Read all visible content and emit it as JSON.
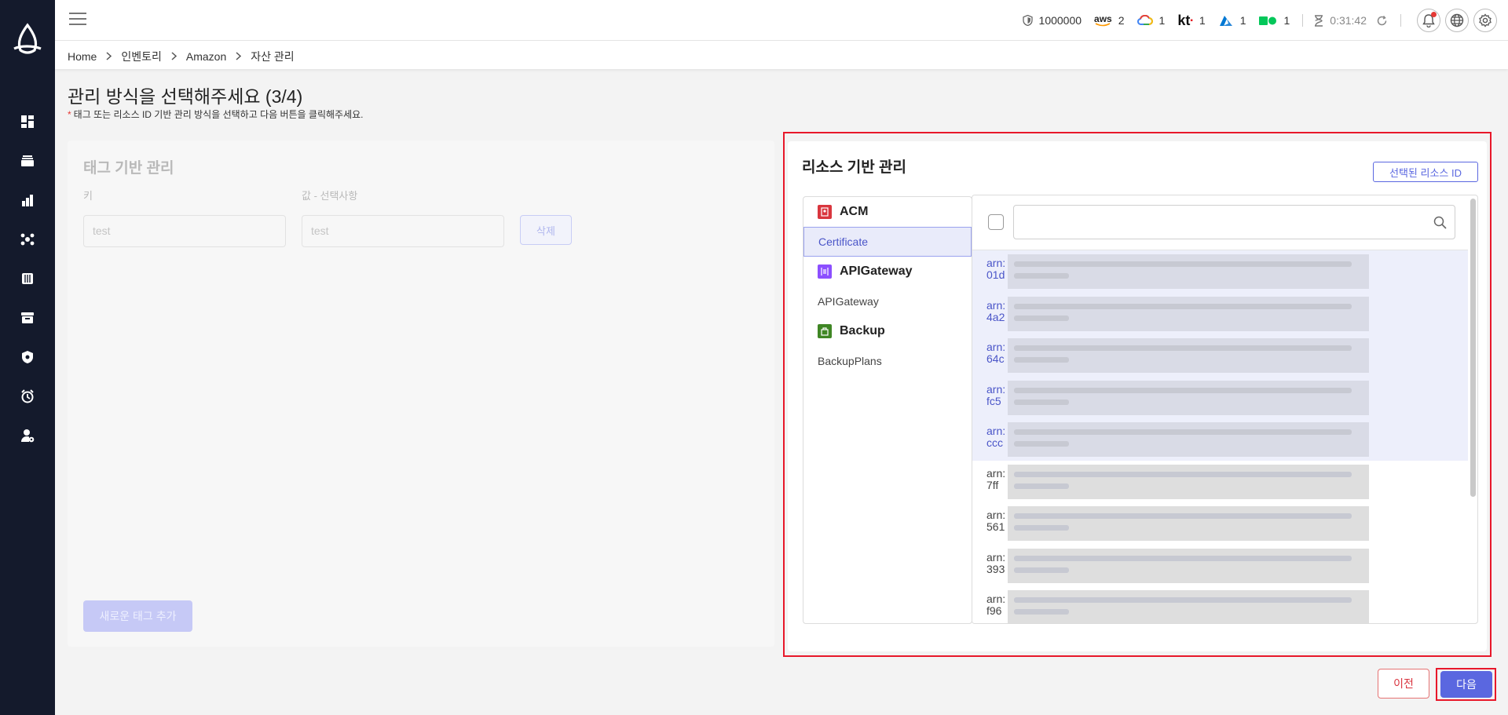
{
  "header": {
    "shield_count": "1000000",
    "providers": [
      {
        "name": "aws",
        "count": "2"
      },
      {
        "name": "gcp",
        "count": "1"
      },
      {
        "name": "kt",
        "count": "1"
      },
      {
        "name": "azure",
        "count": "1"
      },
      {
        "name": "naver",
        "count": "1"
      }
    ],
    "aws_text": "aws",
    "kt_text": "kt",
    "timer": "0:31:42"
  },
  "breadcrumb": [
    "Home",
    "인벤토리",
    "Amazon",
    "자산 관리"
  ],
  "page": {
    "title": "관리 방식을 선택해주세요 (3/4)",
    "subtitle": "태그 또는 리소스 ID 기반 관리 방식을 선택하고 다음 버튼을 클릭해주세요.",
    "required_mark": "*"
  },
  "tag_panel": {
    "title": "태그 기반 관리",
    "key_label": "키",
    "value_label": "값 - 선택사항",
    "key_value": "test",
    "value_value": "test",
    "delete_label": "삭제",
    "add_label": "새로운 태그 추가"
  },
  "resource_panel": {
    "title": "리소스 기반 관리",
    "selected_ids_label": "선택된 리소스 ID",
    "services": [
      {
        "group": "ACM",
        "item": "Certificate",
        "color": "#d9363e"
      },
      {
        "group": "APIGateway",
        "item": "APIGateway",
        "color": "#8c4fff"
      },
      {
        "group": "Backup",
        "item": "BackupPlans",
        "color": "#3f8624"
      }
    ],
    "search_placeholder": "",
    "arn_rows": [
      {
        "prefix": "arn:",
        "suffix": "01d",
        "selected": true
      },
      {
        "prefix": "arn:",
        "suffix": "4a2",
        "selected": true
      },
      {
        "prefix": "arn:",
        "suffix": "64c",
        "selected": true
      },
      {
        "prefix": "arn:",
        "suffix": "fc5",
        "selected": true
      },
      {
        "prefix": "arn:",
        "suffix": "ccc",
        "selected": true
      },
      {
        "prefix": "arn:",
        "suffix": "7ff",
        "selected": false
      },
      {
        "prefix": "arn:",
        "suffix": "561",
        "selected": false
      },
      {
        "prefix": "arn:",
        "suffix": "393",
        "selected": false
      },
      {
        "prefix": "arn:",
        "suffix": "f96",
        "selected": false
      }
    ]
  },
  "footer": {
    "prev_label": "이전",
    "next_label": "다음"
  },
  "colors": {
    "sidebar": "#141a2c",
    "accent": "#5a67e0",
    "highlight": "#e8182a"
  }
}
